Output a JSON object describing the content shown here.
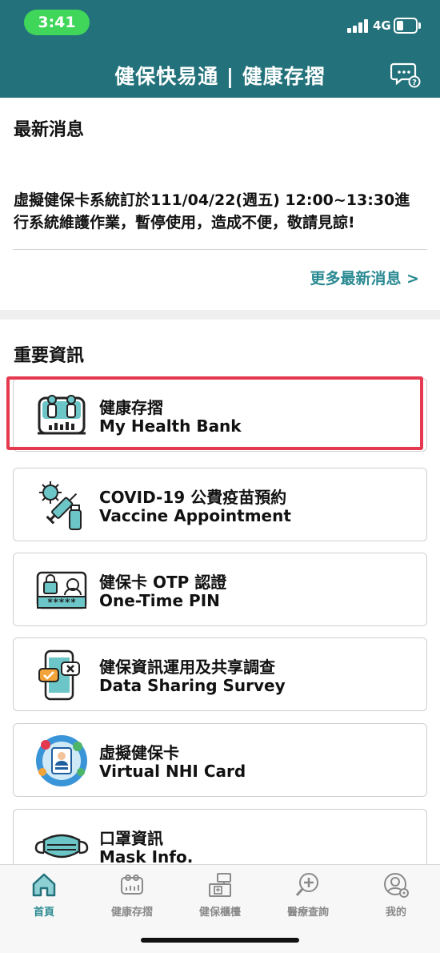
{
  "status_bar": {
    "time": "3:41",
    "network": "4G"
  },
  "header": {
    "title": "健保快易通 | 健康存摺"
  },
  "news": {
    "title": "最新消息",
    "lines": [
      "虛擬健保卡系統訂於111/04/22(週五) 12:00~13:30進",
      "行系統維護作業，暫停使用，造成不便，敬請見諒!"
    ],
    "more_link": "更多最新消息 >"
  },
  "important": {
    "title": "重要資訊",
    "items": [
      {
        "zh": "健康存摺",
        "en": "My Health Bank",
        "icon": "health-bank-icon",
        "highlighted": true
      },
      {
        "zh": "COVID-19 公費疫苗預約",
        "en": "Vaccine Appointment",
        "icon": "vaccine-icon"
      },
      {
        "zh": "健保卡 OTP 認證",
        "en": "One-Time PIN",
        "icon": "otp-card-icon"
      },
      {
        "zh": "健保資訊運用及共享調查",
        "en": "Data Sharing Survey",
        "icon": "survey-phone-icon"
      },
      {
        "zh": "虛擬健保卡",
        "en": "Virtual NHI Card",
        "icon": "virtual-card-icon"
      },
      {
        "zh": "口罩資訊",
        "en": "Mask Info.",
        "icon": "mask-icon"
      }
    ]
  },
  "tabbar": {
    "tabs": [
      {
        "label": "首頁",
        "icon": "home-icon",
        "active": true
      },
      {
        "label": "健康存摺",
        "icon": "health-bank-tab-icon"
      },
      {
        "label": "健保櫃檯",
        "icon": "counter-icon"
      },
      {
        "label": "醫療查詢",
        "icon": "medical-search-icon"
      },
      {
        "label": "我的",
        "icon": "profile-icon"
      }
    ]
  },
  "colors": {
    "header_bg": "#23717a",
    "accent": "#2a8a92",
    "highlight_border": "#e53950",
    "time_pill": "#3fd65a"
  }
}
